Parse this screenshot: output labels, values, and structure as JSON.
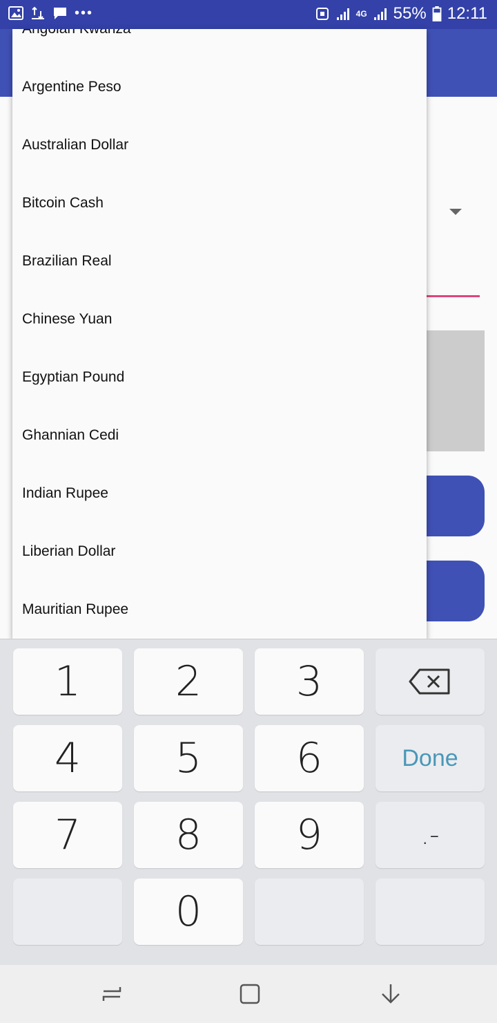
{
  "status_bar": {
    "signal_label": "4G",
    "battery": "55%",
    "time": "12:11",
    "overflow": "•••"
  },
  "dropdown": {
    "items": [
      "Angolan Kwanza",
      "Argentine Peso",
      "Australian Dollar",
      "Bitcoin Cash",
      "Brazilian Real",
      "Chinese Yuan",
      "Egyptian Pound",
      "Ghannian Cedi",
      "Indian Rupee",
      "Liberian Dollar",
      "Mauritian Rupee"
    ]
  },
  "keyboard": {
    "keys": {
      "k1": "1",
      "k2": "2",
      "k3": "3",
      "k4": "4",
      "k5": "5",
      "k6": "6",
      "k7": "7",
      "k8": "8",
      "k9": "9",
      "k0": "0",
      "done": "Done",
      "dot_dash": ".-"
    }
  },
  "colors": {
    "status_bar": "#3341a8",
    "app_bar": "#3f51b5",
    "accent_underline": "#e0457b",
    "done_text": "#4a97b8"
  }
}
